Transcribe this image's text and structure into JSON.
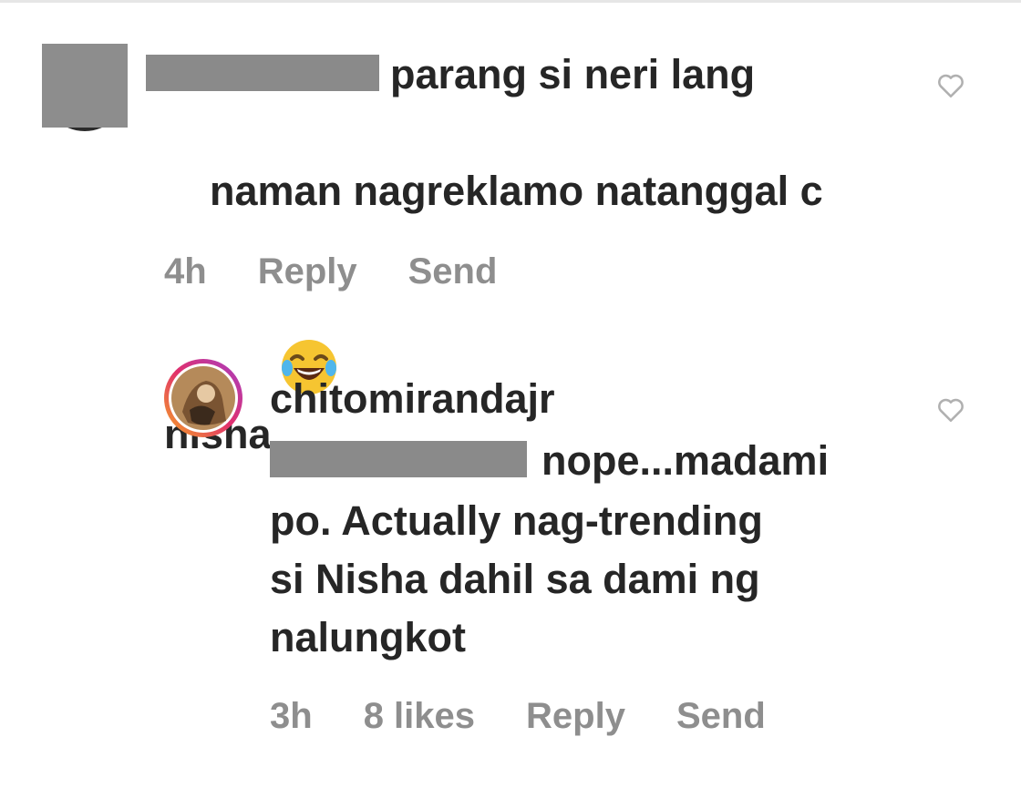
{
  "comments": [
    {
      "username_redacted": true,
      "text_line1": "parang si neri lang",
      "text_rest": "naman nagreklamo natanggal c\nnisha",
      "emoji": "😂",
      "time": "4h",
      "reply_label": "Reply",
      "send_label": "Send"
    },
    {
      "username": "chitomirandajr",
      "mention_redacted": true,
      "text_line1": "nope...madami",
      "text_rest": "po. Actually nag-trending\nsi Nisha dahil sa dami ng\nnalungkot",
      "time": "3h",
      "likes": "8 likes",
      "reply_label": "Reply",
      "send_label": "Send"
    }
  ],
  "icons": {
    "like": "heart-outline-icon",
    "emoji": "face-with-tears-of-joy"
  },
  "colors": {
    "text": "#262626",
    "meta": "#8e8e8e",
    "redaction": "#8a8a8a",
    "heart": "#b0b0b0"
  }
}
